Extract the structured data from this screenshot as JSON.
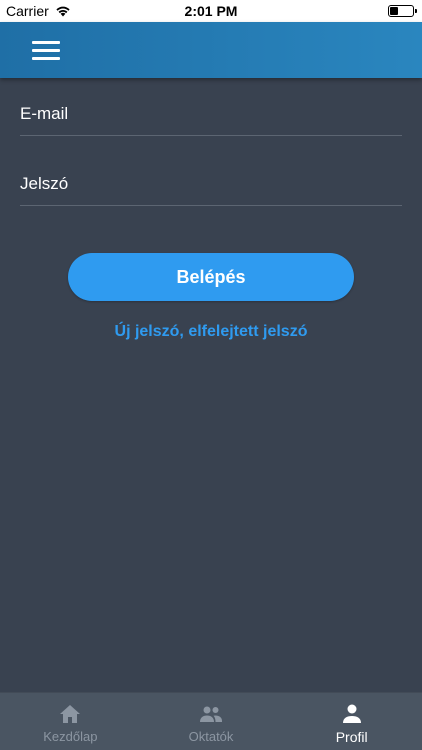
{
  "status_bar": {
    "carrier": "Carrier",
    "time": "2:01 PM",
    "battery_level": 0.35
  },
  "header": {
    "menu_icon": "hamburger-menu-icon"
  },
  "form": {
    "email_placeholder": "E-mail",
    "email_value": "",
    "password_placeholder": "Jelszó",
    "password_value": "",
    "login_label": "Belépés",
    "forgot_label": "Új jelszó, elfelejtett jelszó"
  },
  "tabbar": {
    "tabs": [
      {
        "label": "Kezdőlap",
        "icon": "home-icon",
        "active": false
      },
      {
        "label": "Oktatók",
        "icon": "group-icon",
        "active": false
      },
      {
        "label": "Profil",
        "icon": "person-icon",
        "active": true
      }
    ]
  },
  "colors": {
    "background": "#394250",
    "header": "#2a86bf",
    "accent": "#2f9bf0",
    "tabbar": "#4a5562",
    "inactive_tab": "#8c96a2"
  }
}
